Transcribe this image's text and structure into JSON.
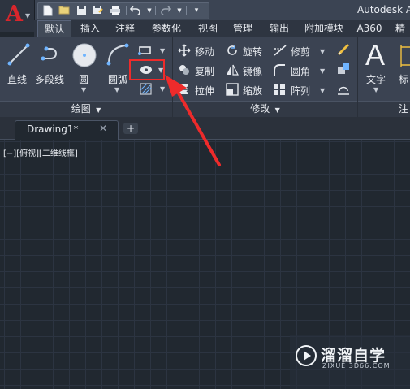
{
  "titlebar": {
    "app_letter": "A",
    "title": "Autodesk A"
  },
  "quick_access_icons": [
    "new-file-icon",
    "open-folder-icon",
    "save-icon",
    "save-as-icon",
    "print-icon",
    "undo-icon",
    "redo-icon"
  ],
  "tabs": [
    {
      "label": "默认",
      "active": true
    },
    {
      "label": "插入",
      "active": false
    },
    {
      "label": "注释",
      "active": false
    },
    {
      "label": "参数化",
      "active": false
    },
    {
      "label": "视图",
      "active": false
    },
    {
      "label": "管理",
      "active": false
    },
    {
      "label": "输出",
      "active": false
    },
    {
      "label": "附加模块",
      "active": false
    },
    {
      "label": "A360",
      "active": false
    },
    {
      "label": "精",
      "active": false
    }
  ],
  "draw_panel": {
    "title": "绘图",
    "tools": [
      {
        "label": "直线",
        "icon": "line-icon"
      },
      {
        "label": "多段线",
        "icon": "polyline-icon"
      },
      {
        "label": "圆",
        "icon": "circle-icon"
      },
      {
        "label": "圆弧",
        "icon": "arc-icon"
      }
    ],
    "small_tools": [
      "rectangle-icon",
      "ellipse-icon",
      "hatch-icon"
    ]
  },
  "modify_panel": {
    "title": "修改",
    "tools": [
      {
        "label": "移动",
        "icon": "move-icon"
      },
      {
        "label": "旋转",
        "icon": "rotate-icon"
      },
      {
        "label": "修剪",
        "icon": "trim-icon"
      },
      {
        "label": "复制",
        "icon": "copy-icon"
      },
      {
        "label": "镜像",
        "icon": "mirror-icon"
      },
      {
        "label": "圆角",
        "icon": "fillet-icon"
      },
      {
        "label": "拉伸",
        "icon": "stretch-icon"
      },
      {
        "label": "缩放",
        "icon": "scale-icon"
      },
      {
        "label": "阵列",
        "icon": "array-icon"
      }
    ]
  },
  "annotation_panel": {
    "text_label": "文字",
    "second_label": "标",
    "title_partial": "注"
  },
  "document": {
    "tab_label": "Drawing1*",
    "close": "✕",
    "add": "+"
  },
  "viewport": {
    "label": "[−][俯视][二维线框]"
  },
  "watermark": {
    "title": "溜溜自学",
    "subtitle": "ZIXUE.3D66.COM"
  },
  "colors": {
    "highlight": "#ee2b2b",
    "app_logo": "#d8262c",
    "canvas": "#212830"
  }
}
